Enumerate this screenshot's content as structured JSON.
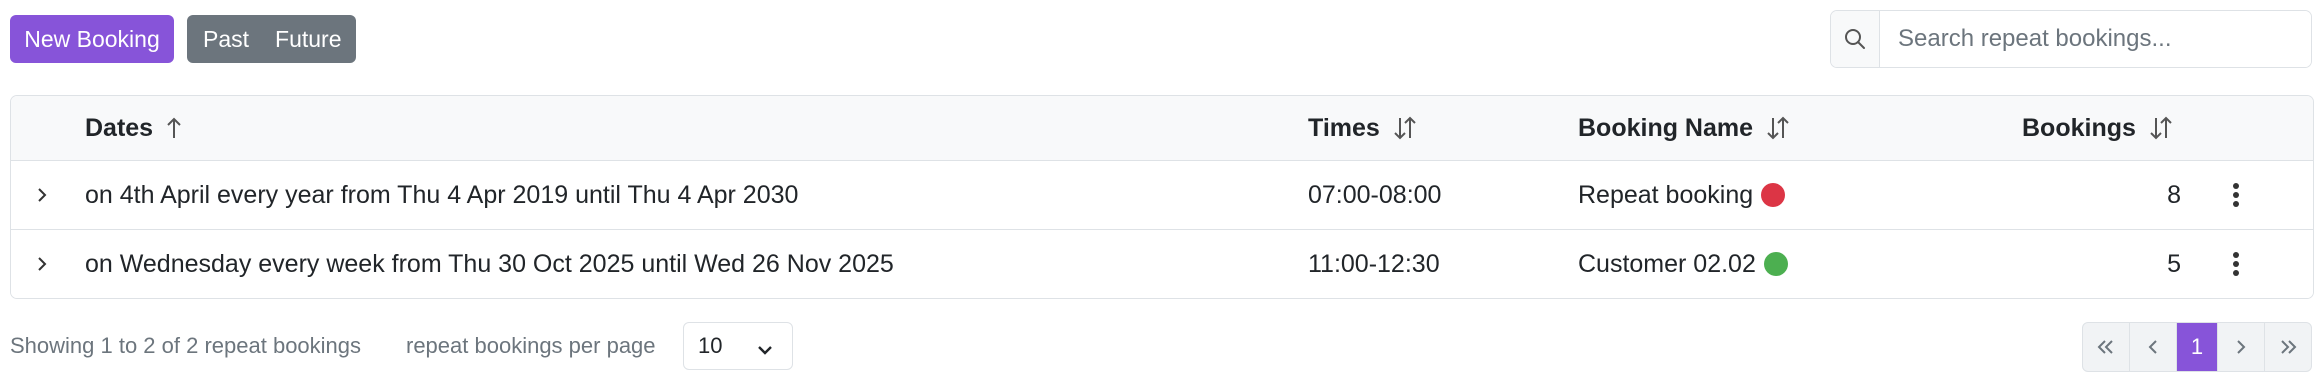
{
  "toolbar": {
    "new_booking_label": "New Booking",
    "past_label": "Past",
    "future_label": "Future",
    "search_placeholder": "Search repeat bookings..."
  },
  "table": {
    "columns": [
      "Dates",
      "Times",
      "Booking Name",
      "Bookings"
    ],
    "rows": [
      {
        "dates": "on 4th April every year from Thu 4 Apr 2019 until Thu 4 Apr 2030",
        "times": "07:00-08:00",
        "name": "Repeat booking",
        "status_color": "#dc3545",
        "bookings": "8"
      },
      {
        "dates": "on Wednesday every week from Thu 30 Oct 2025 until Wed 26 Nov 2025",
        "times": "11:00-12:30",
        "name": "Customer 02.02",
        "status_color": "#4caf50",
        "bookings": "5"
      }
    ]
  },
  "footer": {
    "info": "Showing 1 to 2 of 2 repeat bookings",
    "per_page_label": "repeat bookings per page",
    "per_page_value": "10",
    "current_page": "1"
  },
  "colors": {
    "accent": "#8754d9",
    "secondary": "#6c757d"
  }
}
